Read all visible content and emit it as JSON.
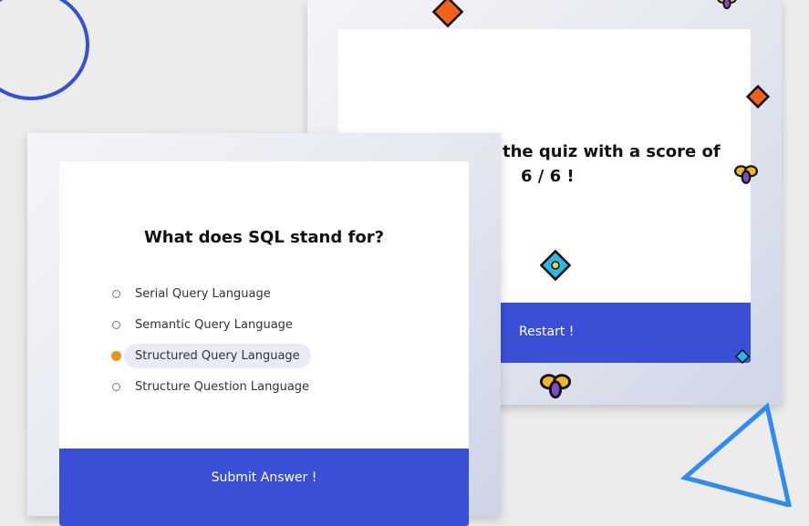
{
  "result_card": {
    "message_line1": "the quiz with a score of",
    "message_line2": "6 / 6 !",
    "restart_label": "Restart !"
  },
  "quiz_card": {
    "question": "What does SQL stand for?",
    "answers": [
      {
        "label": "Serial Query Language",
        "selected": false
      },
      {
        "label": "Semantic Query Language",
        "selected": false
      },
      {
        "label": "Structured Query Language",
        "selected": true
      },
      {
        "label": "Structure Question Language",
        "selected": false
      }
    ],
    "submit_label": "Submit Answer !"
  },
  "decorations": {
    "circle_color": "#3550d4",
    "triangle_color": "#2f8bf0",
    "diamond_orange": "#f0621a",
    "diamond_blue": "#2eb6e6",
    "accent": "#3a4fd6",
    "radio_selected": "#f0921e",
    "icons": [
      "diamond-icon",
      "bee-icon",
      "diamond-blue-icon"
    ]
  }
}
